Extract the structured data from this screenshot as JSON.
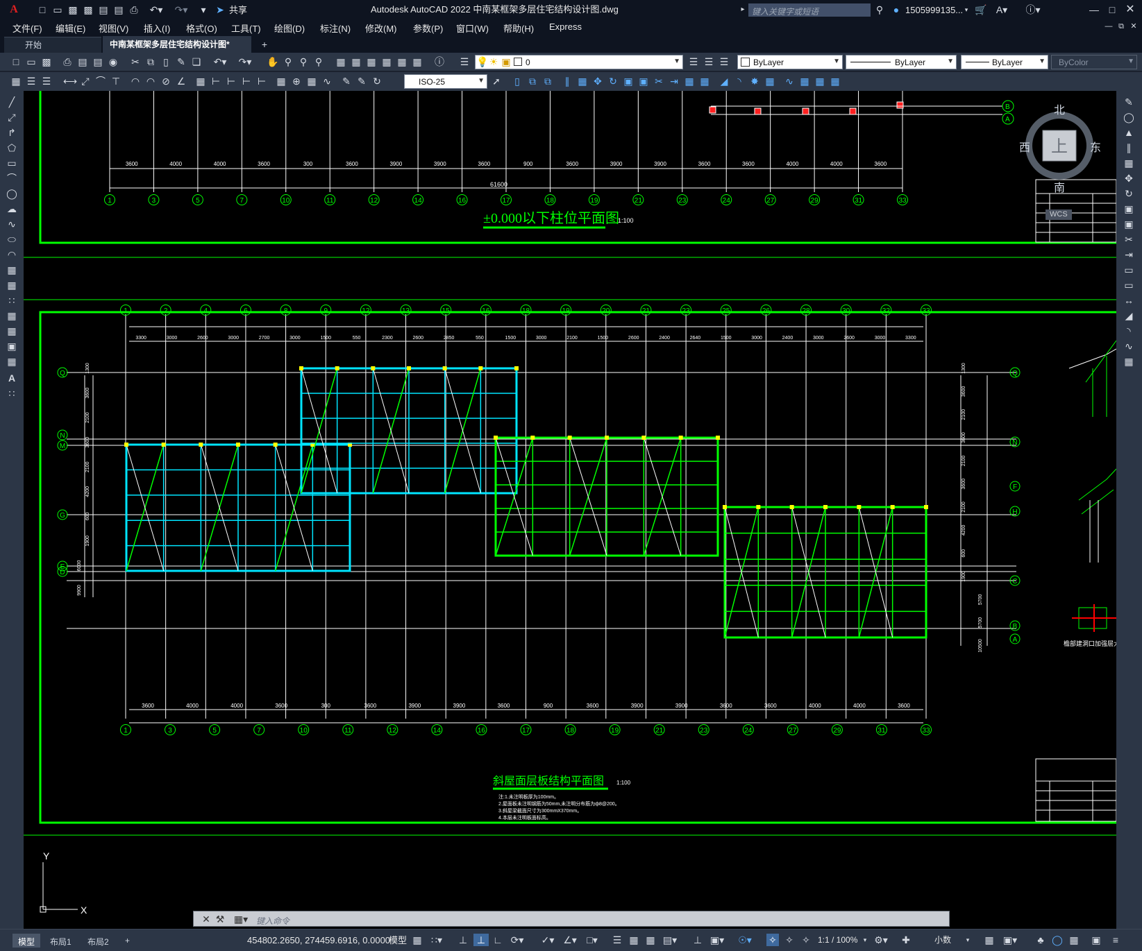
{
  "app": {
    "logo": "A",
    "title": "Autodesk AutoCAD 2022    中南某框架多层住宅结构设计图.dwg",
    "share_label": "共享",
    "search_placeholder": "键入关键字或短语",
    "user": "1505999135...",
    "window_controls": [
      "minimize-icon",
      "restore-icon",
      "close-icon"
    ]
  },
  "menu": [
    "文件(F)",
    "编辑(E)",
    "视图(V)",
    "插入(I)",
    "格式(O)",
    "工具(T)",
    "绘图(D)",
    "标注(N)",
    "修改(M)",
    "参数(P)",
    "窗口(W)",
    "帮助(H)",
    "Express"
  ],
  "doc_tabs": {
    "start": "开始",
    "active": "中南某框架多层住宅结构设计图*",
    "add": "+"
  },
  "toolbar": {
    "layer_value": "0",
    "color_value": "ByLayer",
    "linetype_value": "ByLayer",
    "lineweight_value": "ByLayer",
    "plotstyle_value": "ByColor",
    "dimstyle_value": "ISO-25"
  },
  "viewcube": {
    "north": "北",
    "south": "南",
    "west": "西",
    "east": "东",
    "top": "上",
    "wcs": "WCS"
  },
  "drawing": {
    "top_plan_title": "±0.000以下柱位平面图",
    "top_plan_scale": "1:100",
    "top_total_dim": "61600",
    "main_plan_title": "斜屋面层板结构平面图",
    "main_plan_scale": "1:100",
    "notes": [
      "注:1.未注明板厚为100mm。",
      "   2.屋面板未注明钢筋为50mm,未注明分布筋为ф8@200。",
      "   3.斜屋梁截面尺寸为300mmX370mm。",
      "   4.本层未注明板面标高。"
    ],
    "detail_caption": "檐部建洞口加强层大样",
    "top_dims": [
      "3600",
      "4000",
      "4000",
      "3600",
      "300",
      "3600",
      "3900",
      "3900",
      "3600",
      "900",
      "3600",
      "3900",
      "3900",
      "3600",
      "3600",
      "4000",
      "4000",
      "3600"
    ],
    "top_axis_labels": [
      "1",
      "3",
      "5",
      "7",
      "10",
      "11",
      "12",
      "14",
      "16",
      "17",
      "18",
      "19",
      "21",
      "23",
      "24",
      "27",
      "29",
      "31",
      "33"
    ],
    "main_top_axis_labels": [
      "1",
      "2",
      "4",
      "6",
      "8",
      "9",
      "12",
      "13",
      "15",
      "16",
      "18",
      "19",
      "20",
      "21",
      "23",
      "25",
      "26",
      "28",
      "30",
      "32",
      "33"
    ],
    "main_top_dims": [
      "3300",
      "3000",
      "2600",
      "3000",
      "2700",
      "3000",
      "1500",
      "550",
      "2300",
      "2600",
      "2850",
      "550",
      "1500",
      "3000",
      "2100",
      "1500",
      "2600",
      "2400",
      "2640",
      "1500",
      "3000",
      "2400",
      "3000",
      "2600",
      "3000",
      "3300"
    ],
    "main_bottom_axis_labels": [
      "1",
      "3",
      "5",
      "7",
      "10",
      "11",
      "12",
      "14",
      "16",
      "17",
      "18",
      "19",
      "21",
      "23",
      "24",
      "27",
      "29",
      "31",
      "33"
    ],
    "main_bottom_dims": [
      "3600",
      "4000",
      "4000",
      "3600",
      "300",
      "3600",
      "3900",
      "3900",
      "3600",
      "900",
      "3600",
      "3900",
      "3900",
      "3600",
      "3600",
      "4000",
      "4000",
      "3600"
    ],
    "left_axis_labels": [
      "Q",
      "N",
      "M",
      "G",
      "E",
      "D"
    ],
    "right_axis_labels": [
      "Q",
      "N",
      "F",
      "H",
      "C",
      "B",
      "A"
    ],
    "left_dims": [
      "1300",
      "3600",
      "2100",
      "3600",
      "2100",
      "4200",
      "600",
      "1900",
      "6000",
      "9900"
    ],
    "right_dims": [
      "1300",
      "3600",
      "2100",
      "3600",
      "2100",
      "3600",
      "2100",
      "4200",
      "600",
      "1900",
      "5700",
      "5700",
      "10500"
    ],
    "ucs": {
      "x": "X",
      "y": "Y"
    }
  },
  "command": {
    "placeholder": "键入命令"
  },
  "layout_tabs": [
    "模型",
    "布局1",
    "布局2",
    "+"
  ],
  "status": {
    "coords": "454802.2650, 274459.6916, 0.0000",
    "model": "模型",
    "scale": "1:1 / 100%",
    "units": "小数"
  },
  "colors": {
    "bg": "#000000",
    "ui": "#2c3646",
    "frame": "#00ff00",
    "cyan": "#00e5ff",
    "white": "#ffffff",
    "red": "#ff0000",
    "yellow": "#ffff00"
  }
}
